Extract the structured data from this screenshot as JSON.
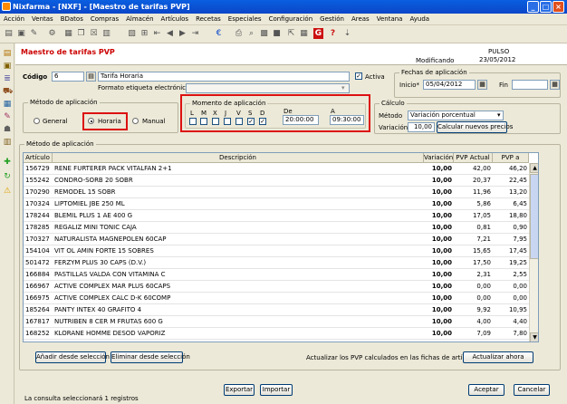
{
  "window": {
    "title": "Nixfarma - [NXF] - [Maestro de tarifas PVP]"
  },
  "menu": [
    "Acción",
    "Ventas",
    "BDatos",
    "Compras",
    "Almacén",
    "Artículos",
    "Recetas",
    "Especiales",
    "Configuración",
    "Gestión",
    "Areas",
    "Ventana",
    "Ayuda"
  ],
  "header": {
    "title": "Maestro de tarifas PVP",
    "status": "Modificando",
    "user": "PULSO",
    "date": "23/05/2012"
  },
  "codigo": {
    "label": "Código",
    "value": "6",
    "name_value": "Tarifa Horaria",
    "activa_label": "Activa",
    "formato_label": "Formato etiqueta electrónica"
  },
  "fechas": {
    "caption": "Fechas de aplicación",
    "inicio_label": "Inicio*",
    "inicio_value": "05/04/2012",
    "fin_label": "Fin",
    "fin_value": ""
  },
  "metodo": {
    "caption": "Método de aplicación",
    "general": "General",
    "horaria": "Horaria",
    "manual": "Manual"
  },
  "momento": {
    "caption": "Momento de aplicación",
    "days": [
      "L",
      "M",
      "X",
      "J",
      "V",
      "S",
      "D"
    ],
    "de_label": "De",
    "de_value": "20:00:00",
    "a_label": "A",
    "a_value": "09:30:00"
  },
  "calculo": {
    "caption": "Cálculo",
    "metodo_label": "Método",
    "metodo_value": "Variación porcentual",
    "variacion_label": "Variación",
    "variacion_value": "10,00",
    "calc_button": "Calcular nuevos precios"
  },
  "table": {
    "caption": "Método de aplicación",
    "columns": [
      "Artículo",
      "Descripción",
      "Variación",
      "PVP Actual",
      "PVP a Aplicar"
    ],
    "rows": [
      [
        "156729",
        "RENE FURTERER PACK VITALFAN 2+1",
        "10,00",
        "42,00",
        "46,20"
      ],
      [
        "155242",
        "CONDRO-SORB 20 SOBR",
        "10,00",
        "20,37",
        "22,45"
      ],
      [
        "170290",
        "REMODEL 15 SOBR",
        "10,00",
        "11,96",
        "13,20"
      ],
      [
        "170324",
        "LIPTOMIEL JBE 250 ML",
        "10,00",
        "5,86",
        "6,45"
      ],
      [
        "178244",
        "BLEMIL PLUS 1 AE 400 G",
        "10,00",
        "17,05",
        "18,80"
      ],
      [
        "178285",
        "REGALIZ MINI TONIC CAJA",
        "10,00",
        "0,81",
        "0,90"
      ],
      [
        "170327",
        "NATURALISTA MAGNEPOLEN 60CAP",
        "10,00",
        "7,21",
        "7,95"
      ],
      [
        "154104",
        "VIT OL AMIN FORTE 15 SOBRES",
        "10,00",
        "15,65",
        "17,45"
      ],
      [
        "501472",
        "FERZYM PLUS 30 CAPS (D.V.)",
        "10,00",
        "17,50",
        "19,25"
      ],
      [
        "166884",
        "PASTILLAS VALDA CON VITAMINA C",
        "10,00",
        "2,31",
        "2,55"
      ],
      [
        "166967",
        "ACTIVE COMPLEX MAR PLUS 60CAPS",
        "10,00",
        "0,00",
        "0,00"
      ],
      [
        "166975",
        "ACTIVE COMPLEX CALC D-K 60COMP",
        "10,00",
        "0,00",
        "0,00"
      ],
      [
        "185264",
        "PANTY INTEX 40 GRAFITO 4",
        "10,00",
        "9,92",
        "10,95"
      ],
      [
        "167817",
        "NUTRIBEN 8 CER M FRUTAS 600 G",
        "10,00",
        "4,00",
        "4,40"
      ],
      [
        "168252",
        "KLORANE HOMME DESOD VAPORIZ",
        "10,00",
        "7,09",
        "7,80"
      ]
    ]
  },
  "buttons": {
    "add": "Añadir desde selección",
    "remove": "Eliminar desde selección",
    "update_text": "Actualizar los PVP calculados en las fichas de artículos",
    "update": "Actualizar ahora",
    "export": "Exportar",
    "import": "Importar",
    "accept": "Aceptar",
    "cancel": "Cancelar"
  },
  "statusbar": {
    "text": "La consulta seleccionará 1 registros"
  },
  "colors": {
    "accent_red": "#DD1111",
    "title_red": "#CC0000",
    "titlebar_blue": "#0A5FE0"
  }
}
